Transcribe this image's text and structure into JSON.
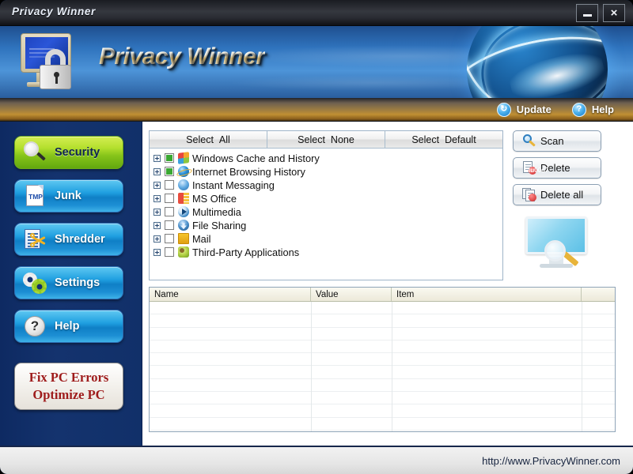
{
  "window": {
    "title": "Privacy Winner",
    "minimize_label": "–",
    "close_label": "×"
  },
  "banner": {
    "brand": "Privacy Winner",
    "logo_icon": "monitor-lock-icon",
    "globe_icon": "globe-graphic"
  },
  "toolbar": {
    "items": [
      {
        "label": "Update",
        "icon": "refresh-icon",
        "glyph": "↻"
      },
      {
        "label": "Help",
        "icon": "question-icon",
        "glyph": "?"
      }
    ]
  },
  "sidebar": {
    "items": [
      {
        "label": "Security",
        "icon": "magnifier-icon",
        "active": true
      },
      {
        "label": "Junk",
        "icon": "tmp-file-icon",
        "active": false
      },
      {
        "label": "Shredder",
        "icon": "shredder-icon",
        "active": false
      },
      {
        "label": "Settings",
        "icon": "gears-icon",
        "active": false
      },
      {
        "label": "Help",
        "icon": "question-mark-icon",
        "active": false
      }
    ],
    "promo": {
      "line1": "Fix PC Errors",
      "line2": "Optimize PC",
      "color": "#9e1b1b"
    }
  },
  "select_bar": [
    {
      "prefix": "Select",
      "suffix": "All"
    },
    {
      "prefix": "Select",
      "suffix": "None"
    },
    {
      "prefix": "Select",
      "suffix": "Default"
    }
  ],
  "tree": {
    "items": [
      {
        "label": "Windows Cache and History",
        "checked": true,
        "icon": "windows-logo-icon"
      },
      {
        "label": "Internet Browsing History",
        "checked": true,
        "icon": "internet-explorer-icon"
      },
      {
        "label": "Instant Messaging",
        "checked": false,
        "icon": "instant-messaging-icon"
      },
      {
        "label": "MS Office",
        "checked": false,
        "icon": "ms-office-icon"
      },
      {
        "label": "Multimedia",
        "checked": false,
        "icon": "multimedia-player-icon"
      },
      {
        "label": "File Sharing",
        "checked": false,
        "icon": "file-sharing-icon"
      },
      {
        "label": "Mail",
        "checked": false,
        "icon": "mail-envelope-icon"
      },
      {
        "label": "Third-Party Applications",
        "checked": false,
        "icon": "third-party-apps-icon"
      }
    ]
  },
  "actions": {
    "buttons": [
      {
        "label": "Scan",
        "icon": "scan-magnifier-icon"
      },
      {
        "label": "Delete",
        "icon": "delete-document-icon"
      },
      {
        "label": "Delete all",
        "icon": "delete-all-documents-icon"
      }
    ],
    "illustration": "monitor-scan-icon"
  },
  "results": {
    "columns": [
      "Name",
      "Value",
      "Item",
      ""
    ],
    "rows": []
  },
  "footer": {
    "url": "http://www.PrivacyWinner.com"
  }
}
